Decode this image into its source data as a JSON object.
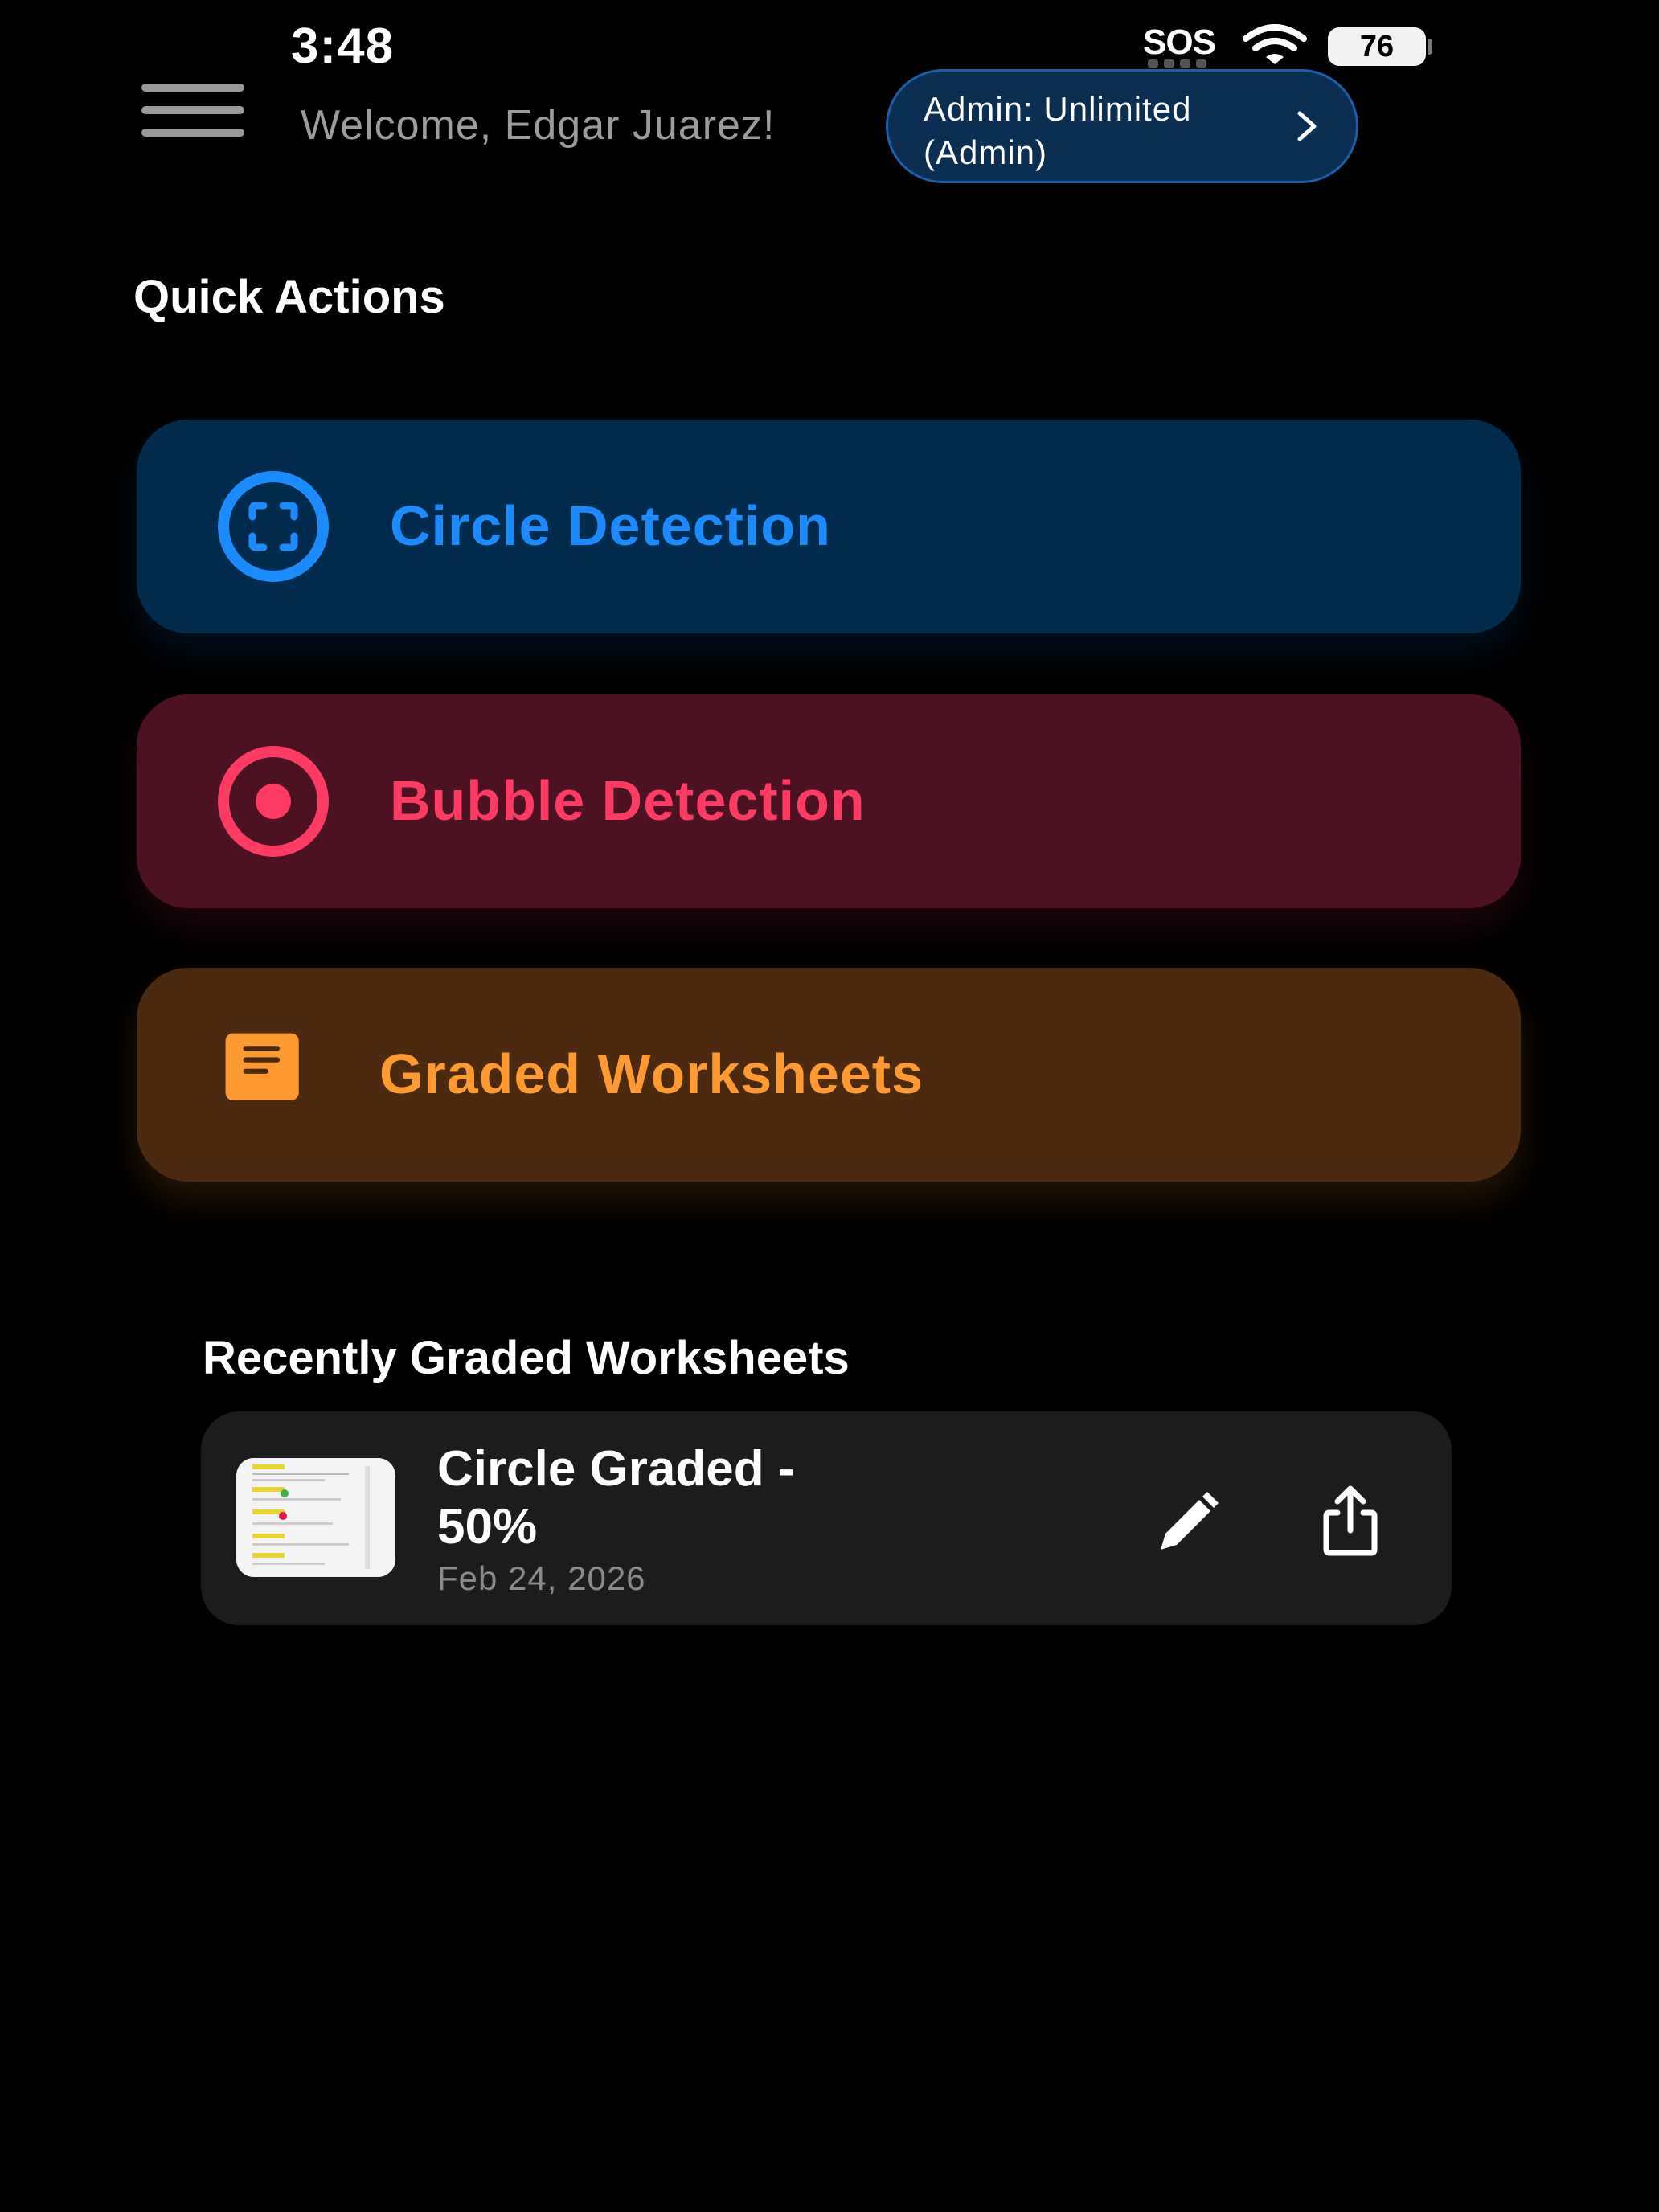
{
  "status_bar": {
    "time": "3:48",
    "sos": "SOS",
    "battery": "76",
    "icons": [
      "wifi-icon",
      "battery-icon"
    ]
  },
  "header": {
    "welcome": "Welcome, Edgar Juarez!",
    "admin_badge": "Admin: Unlimited (Admin)",
    "icons": [
      "menu-icon",
      "chevron-right-icon"
    ]
  },
  "quick_actions": {
    "title": "Quick Actions",
    "items": [
      {
        "label": "Circle Detection",
        "icon": "viewfinder-circle-icon",
        "color": "#1a8cff",
        "bg": "#002b4d"
      },
      {
        "label": "Bubble Detection",
        "icon": "target-circle-icon",
        "color": "#ff3b64",
        "bg": "#4d1221"
      },
      {
        "label": "Graded Worksheets",
        "icon": "document-icon",
        "color": "#ff9a30",
        "bg": "#4c2a10"
      }
    ]
  },
  "recent": {
    "title": "Recently Graded Worksheets",
    "items": [
      {
        "name": "Circle Graded - 50%",
        "date": "Feb 24, 2026",
        "icons": [
          "pencil-icon",
          "share-icon"
        ]
      }
    ]
  }
}
